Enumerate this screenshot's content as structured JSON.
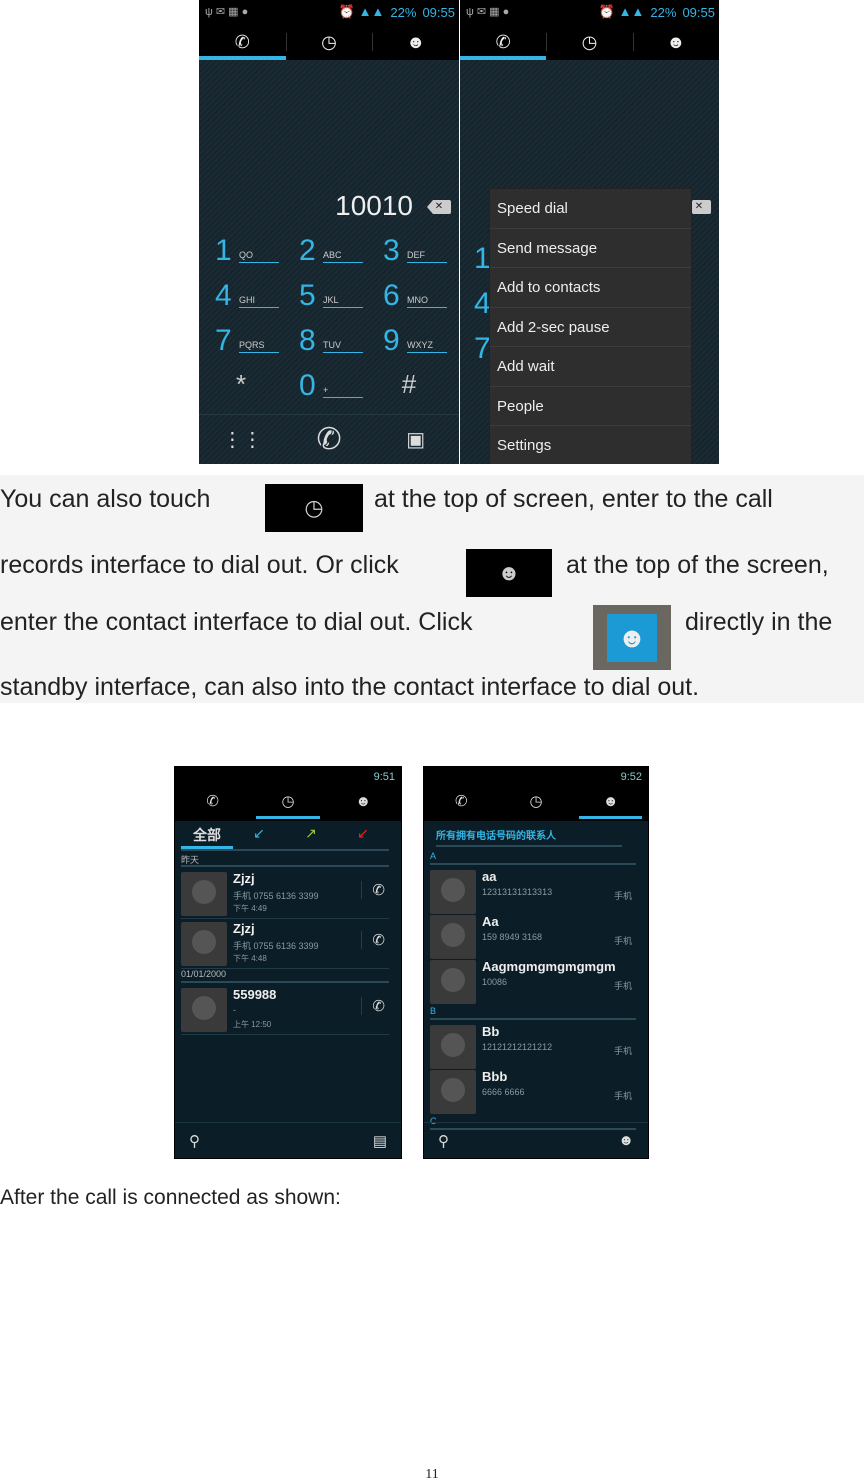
{
  "dialer_screens": [
    {
      "status": {
        "battery": "22%",
        "time": "09:55"
      },
      "tabs": [
        "phone",
        "call-log",
        "contacts"
      ],
      "selected_tab": 0,
      "number": "10010",
      "keys": [
        {
          "n": "1",
          "s": "QO"
        },
        {
          "n": "2",
          "s": "ABC"
        },
        {
          "n": "3",
          "s": "DEF"
        },
        {
          "n": "4",
          "s": "GHI"
        },
        {
          "n": "5",
          "s": "JKL"
        },
        {
          "n": "6",
          "s": "MNO"
        },
        {
          "n": "7",
          "s": "PQRS"
        },
        {
          "n": "8",
          "s": "TUV"
        },
        {
          "n": "9",
          "s": "WXYZ"
        },
        {
          "n": "*",
          "s": ""
        },
        {
          "n": "0",
          "s": "+"
        },
        {
          "n": "#",
          "s": ""
        }
      ]
    },
    {
      "status": {
        "battery": "22%",
        "time": "09:55"
      },
      "menu": [
        "Speed dial",
        "Send message",
        "Add to contacts",
        "Add 2-sec pause",
        "Add wait",
        "People",
        "Settings"
      ]
    }
  ],
  "paragraph": {
    "l1a": "You  can  also  touch",
    "l1b": "at  the  top  of  screen,  enter  to  the  call",
    "l2a": "records interface to dial out. Or click",
    "l2b": "at the top of the screen,",
    "l3a": "enter  the  contact  interface  to  dial  out.  Click",
    "l3b": "directly  in  the",
    "l4": "standby interface, can also into the contact interface to dial out."
  },
  "call_log": {
    "time": "9:51",
    "filters": [
      "全部",
      "↙",
      "↗",
      "↙"
    ],
    "groups": [
      {
        "label": "昨天",
        "rows": [
          {
            "name": "Zjzj",
            "detail": "手机 0755 6136 3399",
            "time": "下午 4:49"
          },
          {
            "name": "Zjzj",
            "detail": "手机 0755 6136 3399",
            "time": "下午 4:48"
          }
        ]
      },
      {
        "label": "01/01/2000",
        "rows": [
          {
            "name": "559988",
            "detail": "-",
            "time": "上午 12:50"
          }
        ]
      }
    ]
  },
  "contacts": {
    "time": "9:52",
    "header": "所有拥有电话号码的联系人",
    "sections": [
      {
        "letter": "A",
        "rows": [
          {
            "name": "aa",
            "num": "12313131313313",
            "type": "手机"
          },
          {
            "name": "Aa",
            "num": "159 8949 3168",
            "type": "手机"
          },
          {
            "name": "Aagmgmgmgmgmgm",
            "num": "10086",
            "type": "手机"
          }
        ]
      },
      {
        "letter": "B",
        "rows": [
          {
            "name": "Bb",
            "num": "12121212121212",
            "type": "手机"
          },
          {
            "name": "Bbb",
            "num": "6666 6666",
            "type": "手机"
          }
        ]
      },
      {
        "letter": "C",
        "rows": []
      }
    ]
  },
  "caption": "After the call is connected as shown:",
  "page_number": "11"
}
